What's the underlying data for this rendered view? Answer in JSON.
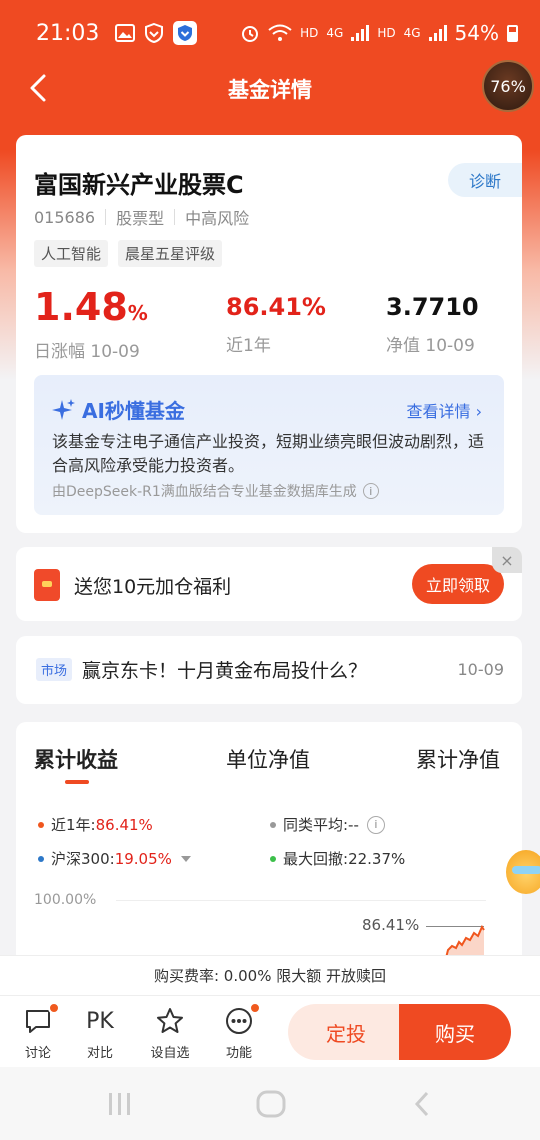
{
  "status_bar": {
    "time": "21:03",
    "net_hd_1": "HD",
    "net_4g_1": "4G",
    "net_hd_2": "HD",
    "net_4g_2": "4G",
    "battery": "54%"
  },
  "nav": {
    "title": "基金详情",
    "float_badge": "76%"
  },
  "fund": {
    "name": "富国新兴产业股票C",
    "diagnose_label": "诊断",
    "code": "015686",
    "type": "股票型",
    "risk": "中高风险",
    "tags": [
      "人工智能",
      "晨星五星评级"
    ],
    "daily_change_value": "1.48",
    "daily_change_unit": "%",
    "daily_change_label": "日涨幅 10-09",
    "year_return_value": "86.41%",
    "year_return_label": "近1年",
    "nav_value": "3.7710",
    "nav_label": "净值 10-09"
  },
  "ai": {
    "title": "AI秒懂基金",
    "link": "查看详情",
    "body": "该基金专注电子通信产业投资，短期业绩亮眼但波动剧烈，适合高风险承受能力投资者。",
    "footer": "由DeepSeek-R1满血版结合专业基金数据库生成"
  },
  "promo": {
    "text": "送您10元加仓福利",
    "button": "立即领取",
    "close": "×"
  },
  "news": {
    "tag": "市场",
    "title": "赢京东卡！十月黄金布局投什么？",
    "date": "10-09"
  },
  "performance": {
    "tabs": [
      "累计收益",
      "单位净值",
      "累计净值"
    ],
    "legend": {
      "fund_label": "近1年:",
      "fund_value": "86.41%",
      "peer_label": "同类平均:--",
      "index_label": "沪深300:",
      "index_value": "19.05%",
      "drawdown_label": "最大回撤:",
      "drawdown_value": "22.37%"
    },
    "y_top_label": "100.00%",
    "end_label": "86.41%",
    "colors": {
      "fund": "#f0561e",
      "peer": "#999999",
      "index": "#2d78c8",
      "drawdown": "#3cbf4a"
    }
  },
  "fee": {
    "text": "购买费率: 0.00% 限大额 开放赎回"
  },
  "actions": {
    "discuss": "讨论",
    "pk_icon": "PK",
    "compare": "对比",
    "watchlist": "设自选",
    "functions": "功能",
    "dingtou": "定投",
    "buy": "购买"
  },
  "icons": [
    "back-icon",
    "gallery-icon",
    "vpn-icon",
    "shield-icon",
    "alarm-icon",
    "wifi-icon",
    "signal-icon",
    "battery-icon",
    "sparkle-icon",
    "info-icon",
    "chat-icon",
    "star-icon",
    "more-icon",
    "redpacket-icon",
    "home-icon",
    "recents-icon"
  ],
  "brand_color": "#ef4a22"
}
